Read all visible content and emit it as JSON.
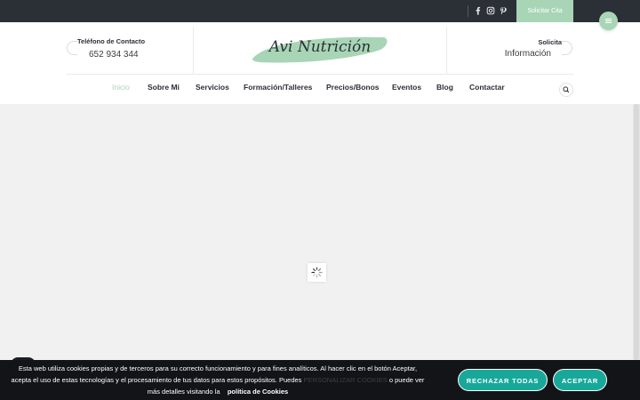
{
  "topbar": {
    "social_icons": [
      "facebook-icon",
      "instagram-icon",
      "pinterest-icon"
    ],
    "cta_label": "Solicitar Cita"
  },
  "header": {
    "contact_label": "Teléfono de Contacto",
    "contact_value": "652 934 344",
    "logo_text": "Avi Nutrición",
    "solicita_label": "Solicita",
    "solicita_value": "Información"
  },
  "nav": {
    "items": [
      {
        "label": "Inicio",
        "active": true
      },
      {
        "label": "Sobre Mi",
        "active": false
      },
      {
        "label": "Servicios",
        "active": false
      },
      {
        "label": "Formación/Talleres",
        "active": false
      },
      {
        "label": "Precios/Bonos",
        "active": false
      },
      {
        "label": "Eventos",
        "active": false
      },
      {
        "label": "Blog",
        "active": false
      },
      {
        "label": "Contactar",
        "active": false
      }
    ]
  },
  "cookie": {
    "text_line1": "Esta web utiliza cookies propias y de terceros para su correcto funcionamiento y para fines analíticos. Al hacer clic en el botón Aceptar,",
    "text_line2_a": "acepta el uso de estas tecnologías y el procesamiento de tus datos para estos propósitos. Puedes",
    "personalize_link": "PERSONALIZAR COOKIES",
    "text_line2_b": "o puede ver",
    "text_line3": "más detalles visitando la",
    "policy_link": "política de Cookies",
    "reject_label": "RECHAZAR TODAS",
    "accept_label": "ACEPTAR"
  },
  "colors": {
    "accent": "#a8d5b6",
    "topbar": "#2b2f36",
    "cookie_bg": "#121417",
    "button": "#18a89a"
  }
}
